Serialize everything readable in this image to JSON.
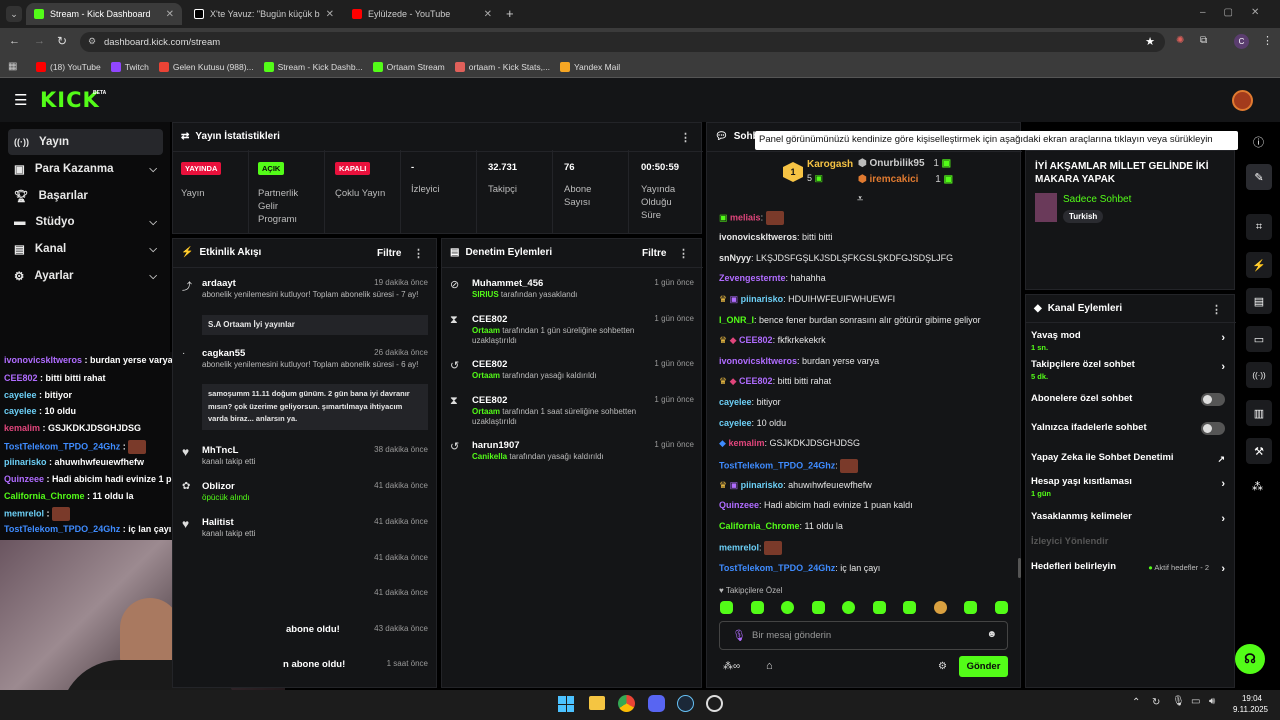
{
  "browser": {
    "tabs": [
      {
        "label": "Stream - Kick Dashboard",
        "color": "#53fc18"
      },
      {
        "label": "X'te Yavuz: \"Bugün küçük bir ya...",
        "color": "#ffffff"
      },
      {
        "label": "Eylülzede - YouTube",
        "color": "#ff0000"
      }
    ],
    "url": "dashboard.kick.com/stream",
    "bookmarks": [
      {
        "label": "(18) YouTube",
        "color": "#ff0000"
      },
      {
        "label": "Twitch",
        "color": "#9146ff"
      },
      {
        "label": "Gelen Kutusu (988)...",
        "color": "#ea4335"
      },
      {
        "label": "Stream - Kick Dashb...",
        "color": "#53fc18"
      },
      {
        "label": "Ortaam Stream",
        "color": "#53fc18"
      },
      {
        "label": "ortaam - Kick Stats,...",
        "color": "#e0605a"
      },
      {
        "label": "Yandex Mail",
        "color": "#f6a623"
      }
    ],
    "profile_initial": "C"
  },
  "kick": {
    "logo": "KICK",
    "logo_sup": "BETA"
  },
  "nav": [
    {
      "label": "Yayın",
      "icon": "broadcast-icon"
    },
    {
      "label": "Para Kazanma",
      "icon": "wallet-icon"
    },
    {
      "label": "Başarılar",
      "icon": "trophy-icon"
    },
    {
      "label": "Stüdyo",
      "icon": "monitor-icon"
    },
    {
      "label": "Kanal",
      "icon": "channel-icon"
    },
    {
      "label": "Ayarlar",
      "icon": "gear-icon"
    }
  ],
  "stats": {
    "title": "Yayın İstatistikleri",
    "items": [
      {
        "badge": "YAYINDA",
        "label": "Yayın"
      },
      {
        "badge": "AÇIK",
        "label": "Partnerlik Gelir Programı"
      },
      {
        "badge": "KAPALI",
        "label": "Çoklu Yayın"
      },
      {
        "value": "-",
        "label": "İzleyici"
      },
      {
        "value": "32.731",
        "label": "Takipçi"
      },
      {
        "value": "76",
        "label": "Abone Sayısı"
      },
      {
        "value": "00:50:59",
        "label": "Yayında Olduğu Süre"
      }
    ]
  },
  "activity": {
    "title": "Etkinlik Akışı",
    "filter": "Filtre",
    "events": [
      {
        "name": "ardaayt",
        "time": "19 dakika önce",
        "desc": "abonelik yenilemesini kutluyor! Toplam abonelik süresi - 7 ay!",
        "msg": "S.A Ortaam İyi yayınlar"
      },
      {
        "name": "cagkan55",
        "time": "26 dakika önce",
        "desc": "abonelik yenilemesini kutluyor! Toplam abonelik süresi - 6 ay!",
        "msg": "samoşumm 11.11 doğum günüm. 2 gün bana iyi davranır mısın? çok üzerime geliyorsun. şımartılmaya ihtiyacım varda biraz... anlarsın ya."
      },
      {
        "name": "MhTncL",
        "time": "38 dakika önce",
        "desc": "kanalı takip etti"
      },
      {
        "name": "Oblizor",
        "time": "41 dakika önce",
        "desc": "öpücük alındı"
      },
      {
        "name": "Halitist",
        "time": "41 dakika önce",
        "desc": "kanalı takip etti"
      },
      {
        "time": "41 dakika önce"
      },
      {
        "time": "41 dakika önce"
      },
      {
        "tail": "abone oldu!",
        "time": "43 dakika önce"
      },
      {
        "tail": "n abone oldu!",
        "time": "1 saat önce"
      }
    ]
  },
  "modlog": {
    "title": "Denetim Eylemleri",
    "filter": "Filtre",
    "items": [
      {
        "name": "Muhammet_456",
        "time": "1 gün önce",
        "actor": "SIRIUS",
        "desc": "tarafından yasaklandı"
      },
      {
        "name": "CEE802",
        "time": "1 gün önce",
        "actor": "Ortaam",
        "desc": "tarafından 1 gün süreliğine sohbetten uzaklaştırıldı"
      },
      {
        "name": "CEE802",
        "time": "1 gün önce",
        "actor": "Ortaam",
        "desc": "tarafından yasağı kaldırıldı"
      },
      {
        "name": "CEE802",
        "time": "1 gün önce",
        "actor": "Ortaam",
        "desc": "tarafından 1 saat süreliğine sohbetten uzaklaştırıldı"
      },
      {
        "name": "harun1907",
        "time": "1 gün önce",
        "actor": "Canikella",
        "desc": "tarafından yasağı kaldırıldı"
      }
    ]
  },
  "chat": {
    "title": "Sohbe",
    "tooltip": "Panel görünümünüzü kendinize göre kişiselleştirmek için aşağıdaki ekran araçlarına tıklayın veya sürükleyin",
    "leaders": [
      {
        "name": "Karogash",
        "count": "5",
        "rank": "1"
      },
      {
        "name": "Onurbilik95",
        "count": "1"
      },
      {
        "name": "iremcakici",
        "count": "1"
      }
    ],
    "messages": [
      {
        "user": "meliais",
        "color": "#e0457b",
        "text": ""
      },
      {
        "user": "ivonovicskltweros",
        "color": "#e6e6e6",
        "text": "bitti bitti"
      },
      {
        "user": "snNyyy",
        "color": "#e6e6e6",
        "text": "LKŞJDSFGŞLKJSDLŞFKGSLŞKDFGJSDŞLJFG"
      },
      {
        "user": "Zevengesternte",
        "color": "#b06cff",
        "text": "hahahha"
      },
      {
        "user": "piinarisko",
        "color": "#6ccff6",
        "text": "HDUIHWFEUIFWHUEWFI"
      },
      {
        "user": "I_ONR_I",
        "color": "#53fc18",
        "text": "bence fener burdan sonrasını alır götürür gibime geliyor"
      },
      {
        "user": "CEE802",
        "color": "#b06cff",
        "text": "fkfkrkekekrk"
      },
      {
        "user": "ivonovicskltweros",
        "color": "#b06cff",
        "text": "burdan yerse varya"
      },
      {
        "user": "CEE802",
        "color": "#b06cff",
        "text": "bitti bitti rahat"
      },
      {
        "user": "cayelee",
        "color": "#6ccff6",
        "text": "bitiyor"
      },
      {
        "user": "cayelee",
        "color": "#6ccff6",
        "text": "10 oldu"
      },
      {
        "user": "kemalim",
        "color": "#e0457b",
        "text": "GSJKDKJDSGHJDSG"
      },
      {
        "user": "TostTelekom_TPDO_24Ghz",
        "color": "#3f8cff",
        "text": ""
      },
      {
        "user": "piinarisko",
        "color": "#6ccff6",
        "text": "ahuwıhwfeuıewfhefw"
      },
      {
        "user": "Quinzeee",
        "color": "#b06cff",
        "text": "Hadi abicim hadi evinize 1 puan kaldı"
      },
      {
        "user": "California_Chrome",
        "color": "#53fc18",
        "text": "11 oldu la"
      },
      {
        "user": "memrelol",
        "color": "#6ccff6",
        "text": ""
      },
      {
        "user": "TostTelekom_TPDO_24Ghz",
        "color": "#3f8cff",
        "text": "iç lan çayı"
      }
    ],
    "followers_only": "Takipçilere Özel",
    "placeholder": "Bir mesaj gönderin",
    "send": "Gönder"
  },
  "overlay_chat": [
    {
      "user": "ivonovicskltweros",
      "color": "#b06cff",
      "text": "burdan yerse varya"
    },
    {
      "user": "CEE802",
      "color": "#b06cff",
      "text": "bitti bitti rahat"
    },
    {
      "user": "cayelee",
      "color": "#6ccff6",
      "text": "bitiyor"
    },
    {
      "user": "cayelee",
      "color": "#6ccff6",
      "text": "10 oldu"
    },
    {
      "user": "kemalim",
      "color": "#e0457b",
      "text": "GSJKDKJDSGHJDSG"
    },
    {
      "user": "TostTelekom_TPDO_24Ghz",
      "color": "#3f8cff",
      "text": ""
    },
    {
      "user": "piinarisko",
      "color": "#6ccff6",
      "text": "ahuwıhwfeuıewfhefw"
    },
    {
      "user": "Quinzeee",
      "color": "#b06cff",
      "text": "Hadi abicim hadi evinize 1 puan kaldı"
    },
    {
      "user": "California_Chrome",
      "color": "#53fc18",
      "text": "11 oldu la"
    },
    {
      "user": "memrelol",
      "color": "#6ccff6",
      "text": ""
    },
    {
      "user": "TostTelekom_TPDO_24Ghz",
      "color": "#3f8cff",
      "text": "iç lan çayı"
    }
  ],
  "stream_info": {
    "title": "İYİ AKŞAMLAR MİLLET GELİNDE İKİ MAKARA YAPAK",
    "category": "Sadece Sohbet",
    "tag": "Turkish"
  },
  "channel_actions": {
    "title": "Kanal Eylemleri",
    "items": [
      {
        "label": "Yavaş mod",
        "sub": "1 sn.",
        "type": "arrow"
      },
      {
        "label": "Takipçilere özel sohbet",
        "sub": "5 dk.",
        "type": "arrow"
      },
      {
        "label": "Abonelere özel sohbet",
        "type": "toggle"
      },
      {
        "label": "Yalnızca ifadelerle sohbet",
        "type": "toggle"
      },
      {
        "label": "Yapay Zeka ile Sohbet Denetimi",
        "type": "external"
      },
      {
        "label": "Hesap yaşı kısıtlaması",
        "sub": "1 gün",
        "type": "arrow"
      },
      {
        "label": "Yasaklanmış kelimeler",
        "type": "arrow"
      },
      {
        "label": "İzleyici Yönlendir",
        "type": "disabled"
      },
      {
        "label": "Hedefleri belirleyin",
        "extra": "Aktif hedefler - 2",
        "type": "arrow"
      }
    ]
  },
  "taskbar": {
    "time": "19:04",
    "date": "9.11.2025"
  },
  "colors": {
    "kick_green": "#53fc18",
    "live_red": "#e9113c",
    "panel": "#141517"
  }
}
